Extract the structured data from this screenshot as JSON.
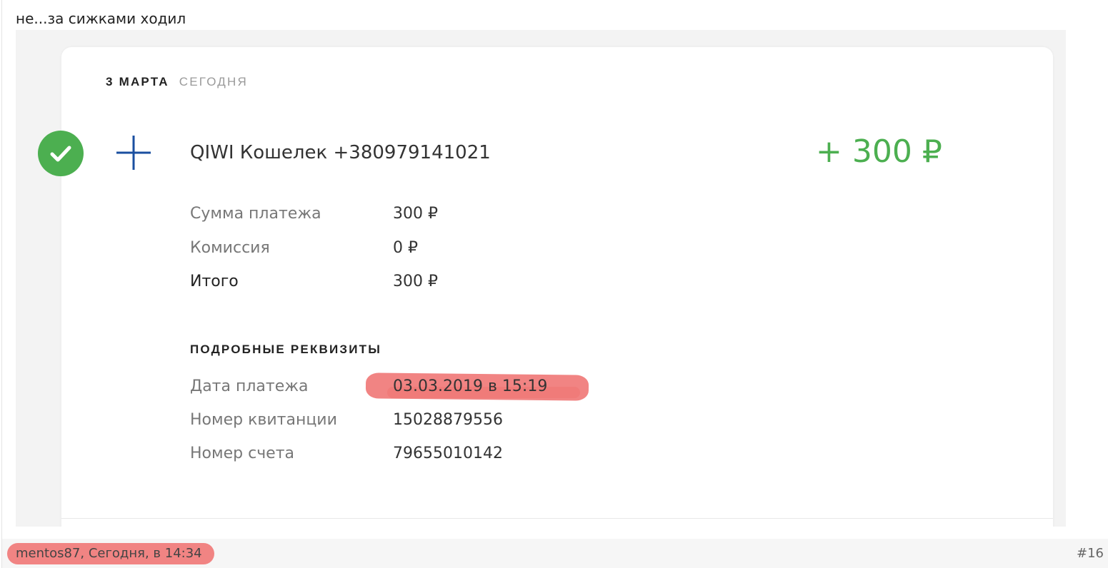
{
  "post": {
    "text": "не...за сижками ходил",
    "author_line": "mentos87, Сегодня, в 14:34",
    "number": "#16"
  },
  "receipt": {
    "date_main": "3 МАРТА",
    "date_today": "СЕГОДНЯ",
    "status_icon": "check-icon",
    "type_icon": "plus-icon",
    "title": "QIWI Кошелек +380979141021",
    "amount": "+ 300 ₽",
    "summary": [
      {
        "label": "Сумма платежа",
        "value": "300 ₽"
      },
      {
        "label": "Комиссия",
        "value": "0 ₽"
      },
      {
        "label": "Итого",
        "value": "300 ₽"
      }
    ],
    "details_title": "ПОДРОБНЫЕ РЕКВИЗИТЫ",
    "details": [
      {
        "label": "Дата платежа",
        "value": "03.03.2019 в 15:19"
      },
      {
        "label": "Номер квитанции",
        "value": "15028879556"
      },
      {
        "label": "Номер счета",
        "value": "79655010142"
      }
    ],
    "colors": {
      "positive": "#4caf50",
      "plus_icon": "#1a4fa0",
      "redaction": "#f07a78"
    }
  }
}
